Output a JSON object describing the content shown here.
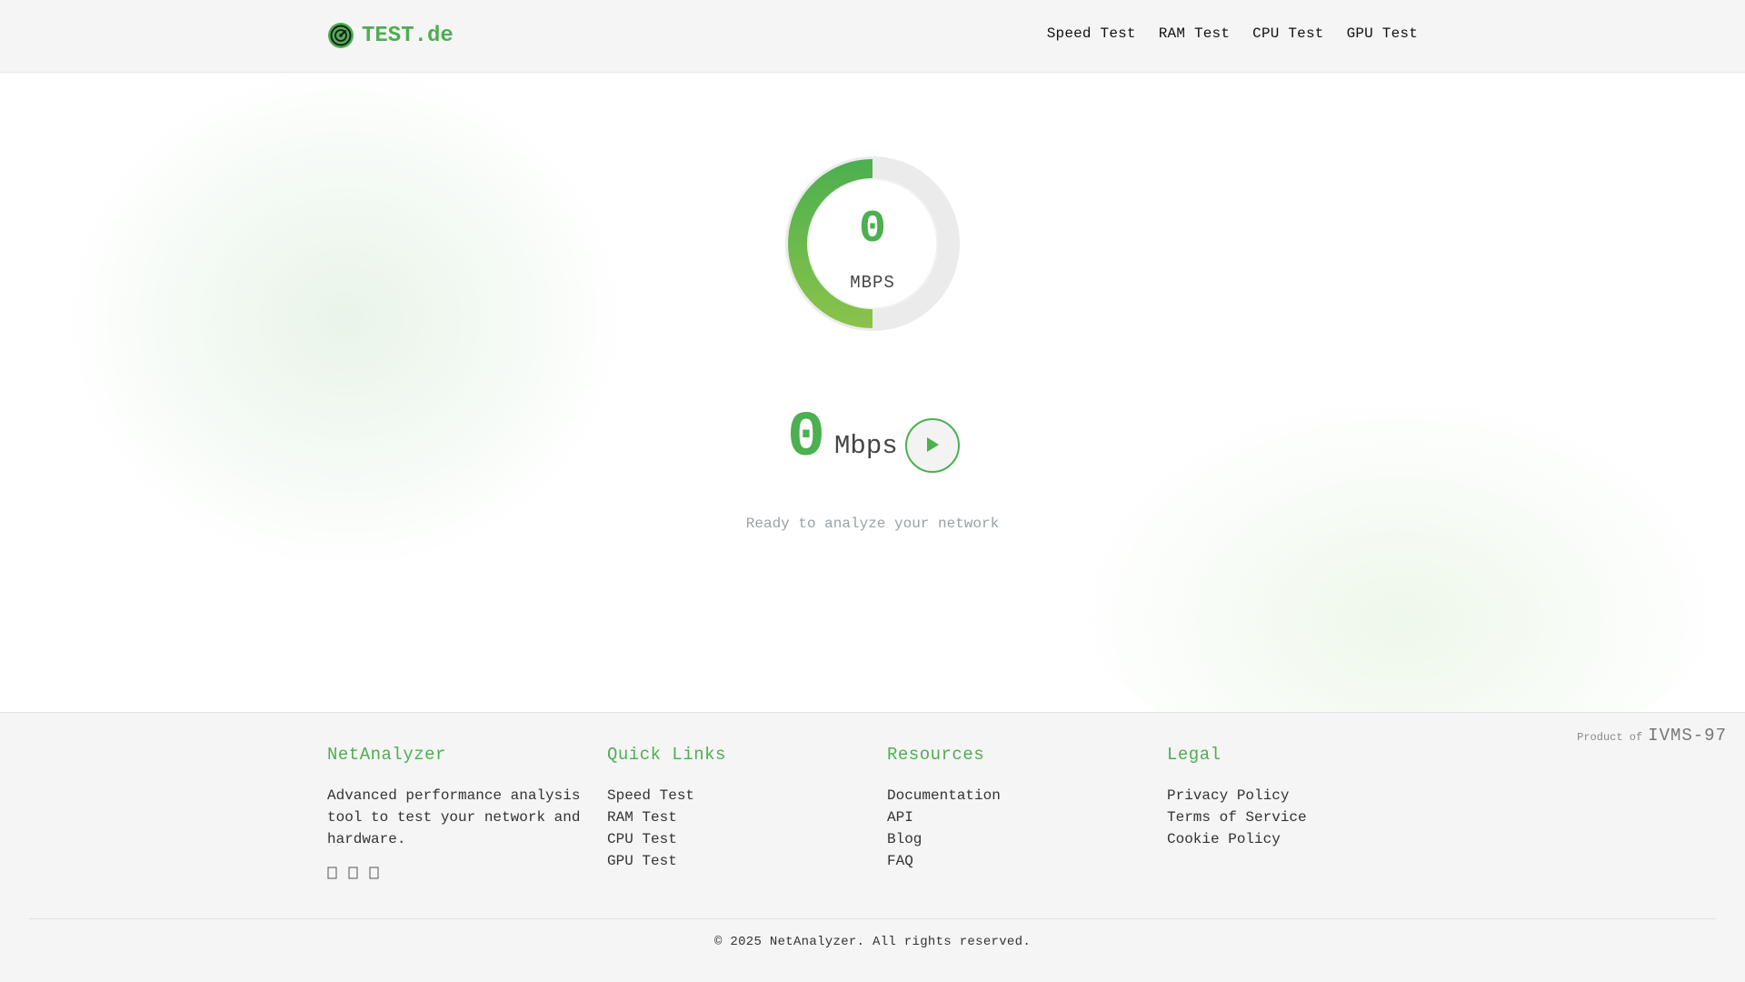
{
  "header": {
    "logo_text": "TEST.de",
    "logo_icon": "speedometer-icon",
    "nav": [
      {
        "label": "Speed Test"
      },
      {
        "label": "RAM Test"
      },
      {
        "label": "CPU Test"
      },
      {
        "label": "GPU Test"
      }
    ]
  },
  "gauge": {
    "value": "0",
    "unit": "MBPS",
    "arc_fraction": 0.5,
    "colors": {
      "track": "#e8e8e8",
      "arc_start": "#4caf50",
      "arc_end": "#8bc34a",
      "inner": "#ffffff"
    }
  },
  "speed": {
    "value": "0",
    "unit": "Mbps",
    "start_button_icon": "play-icon"
  },
  "status": {
    "text": "Ready to analyze your network"
  },
  "footer": {
    "product_prefix": "Product of",
    "product_name": "IVMS-97",
    "brand": {
      "title": "NetAnalyzer",
      "description": "Advanced performance analysis tool to test your network and hardware.",
      "social_icons": [
        "social-icon-1",
        "social-icon-2",
        "social-icon-3"
      ]
    },
    "quick_links": {
      "title": "Quick Links",
      "items": [
        "Speed Test",
        "RAM Test",
        "CPU Test",
        "GPU Test"
      ]
    },
    "resources": {
      "title": "Resources",
      "items": [
        "Documentation",
        "API",
        "Blog",
        "FAQ"
      ]
    },
    "legal": {
      "title": "Legal",
      "items": [
        "Privacy Policy",
        "Terms of Service",
        "Cookie Policy"
      ]
    },
    "copyright": "© 2025 NetAnalyzer. All rights reserved."
  },
  "colors": {
    "accent": "#4caf50",
    "header_bg": "#f5f5f5",
    "footer_bg": "#f5f5f5"
  }
}
